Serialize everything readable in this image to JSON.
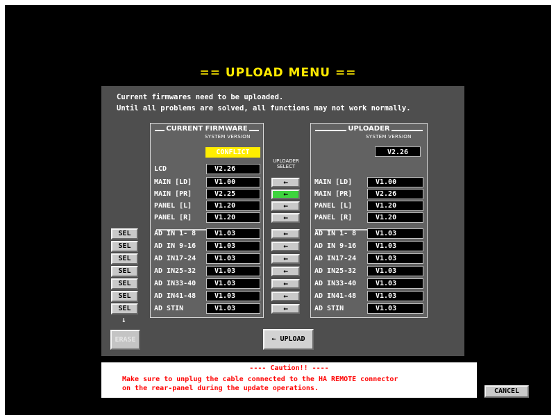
{
  "title": "== UPLOAD MENU ==",
  "messages": [
    "Current firmwares need to be uploaded.",
    "Until all problems are solved, all functions may not work normally."
  ],
  "current_firmware": {
    "title": "CURRENT FIRMWARE",
    "system_version_label": "SYSTEM VERSION",
    "system_version": "CONFLICT",
    "rows": [
      {
        "label": "LCD",
        "value": "V2.26"
      },
      {
        "label": "MAIN [LD]",
        "value": "V1.00"
      },
      {
        "label": "MAIN [PR]",
        "value": "V2.25"
      },
      {
        "label": "PANEL [L]",
        "value": "V1.20"
      },
      {
        "label": "PANEL [R]",
        "value": "V1.20"
      },
      {
        "label": "AD IN 1- 8",
        "value": "V1.03"
      },
      {
        "label": "AD IN 9-16",
        "value": "V1.03"
      },
      {
        "label": "AD IN17-24",
        "value": "V1.03"
      },
      {
        "label": "AD IN25-32",
        "value": "V1.03"
      },
      {
        "label": "AD IN33-40",
        "value": "V1.03"
      },
      {
        "label": "AD IN41-48",
        "value": "V1.03"
      },
      {
        "label": "AD STIN",
        "value": "V1.03"
      }
    ]
  },
  "uploader": {
    "title": "UPLOADER",
    "system_version_label": "SYSTEM VERSION",
    "system_version": "V2.26",
    "rows": [
      {
        "label": "MAIN [LD]",
        "value": "V1.00"
      },
      {
        "label": "MAIN [PR]",
        "value": "V2.26"
      },
      {
        "label": "PANEL [L]",
        "value": "V1.20"
      },
      {
        "label": "PANEL [R]",
        "value": "V1.20"
      },
      {
        "label": "AD IN 1- 8",
        "value": "V1.03"
      },
      {
        "label": "AD IN 9-16",
        "value": "V1.03"
      },
      {
        "label": "AD IN17-24",
        "value": "V1.03"
      },
      {
        "label": "AD IN25-32",
        "value": "V1.03"
      },
      {
        "label": "AD IN33-40",
        "value": "V1.03"
      },
      {
        "label": "AD IN41-48",
        "value": "V1.03"
      },
      {
        "label": "AD STIN",
        "value": "V1.03"
      }
    ]
  },
  "uploader_select_label": "UPLOADER SELECT",
  "arrow_glyph": "←",
  "down_arrow_glyph": "↓",
  "active_arrow_color": "#3ed43e",
  "conflict_color": "#ffee00",
  "sel_label": "SEL",
  "erase_label": "ERASE",
  "upload_label": "← UPLOAD",
  "cancel_label": "CANCEL",
  "caution": {
    "heading": "---- Caution!! ----",
    "line1": "Make sure to unplug the cable connected to the HA REMOTE connector",
    "line2": "on the rear-panel during the update operations."
  }
}
